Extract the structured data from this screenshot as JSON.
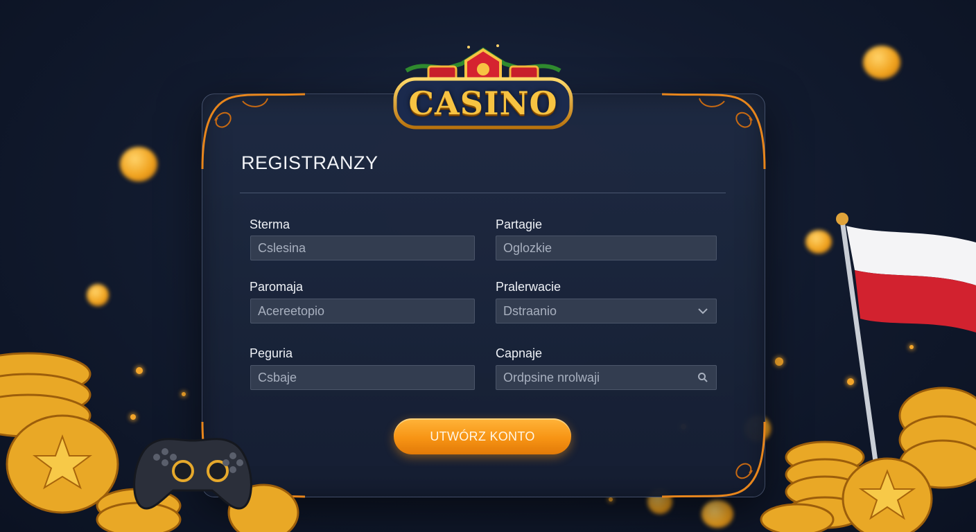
{
  "logo": {
    "text": "CASINO"
  },
  "form": {
    "title": "REGISTRANZY",
    "fields": [
      {
        "label": "Sterma",
        "value": "Cslesina"
      },
      {
        "label": "Partagie",
        "value": "Oglozkie"
      },
      {
        "label": "Paromaja",
        "value": "Acereetopio"
      },
      {
        "label": "Pralerwacie",
        "value": "Dstraanio",
        "icon": "chevron-down-icon"
      },
      {
        "label": "Peguria",
        "value": "Csbaje"
      },
      {
        "label": "Capnaje",
        "value": "Ordpsine nrolwaji",
        "icon": "search-icon"
      }
    ],
    "submit_label": "UTWÓRZ KONTO"
  },
  "colors": {
    "accent": "#f79414",
    "panel": "#1f2a42",
    "gold": "#f7c342"
  },
  "decor": {
    "flag": "poland-flag",
    "controller": "gamepad-icon",
    "coins": "gold-coins"
  }
}
